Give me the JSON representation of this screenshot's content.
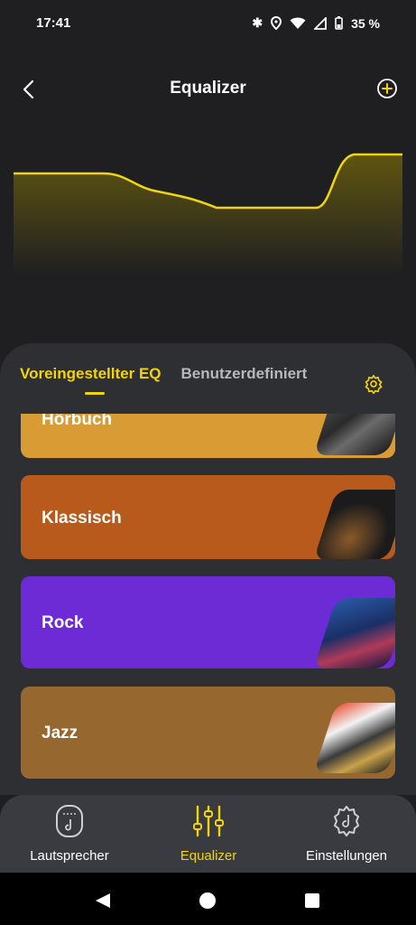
{
  "status_bar": {
    "time": "17:41",
    "battery": "35 %"
  },
  "header": {
    "title": "Equalizer"
  },
  "tabs": {
    "preset": "Voreingestellter EQ",
    "custom": "Benutzerdefiniert"
  },
  "presets": [
    {
      "label": "Hörbuch",
      "color": "#d99c35"
    },
    {
      "label": "Klassisch",
      "color": "#b85a1c"
    },
    {
      "label": "Rock",
      "color": "#6d2bd6"
    },
    {
      "label": "Jazz",
      "color": "#976730"
    }
  ],
  "bottom_nav": {
    "speaker": "Lautsprecher",
    "equalizer": "Equalizer",
    "settings": "Einstellungen"
  },
  "colors": {
    "accent": "#f2d40c",
    "background": "#1f1f21",
    "sheet": "#2e2f33",
    "nav": "#3a3b40"
  }
}
